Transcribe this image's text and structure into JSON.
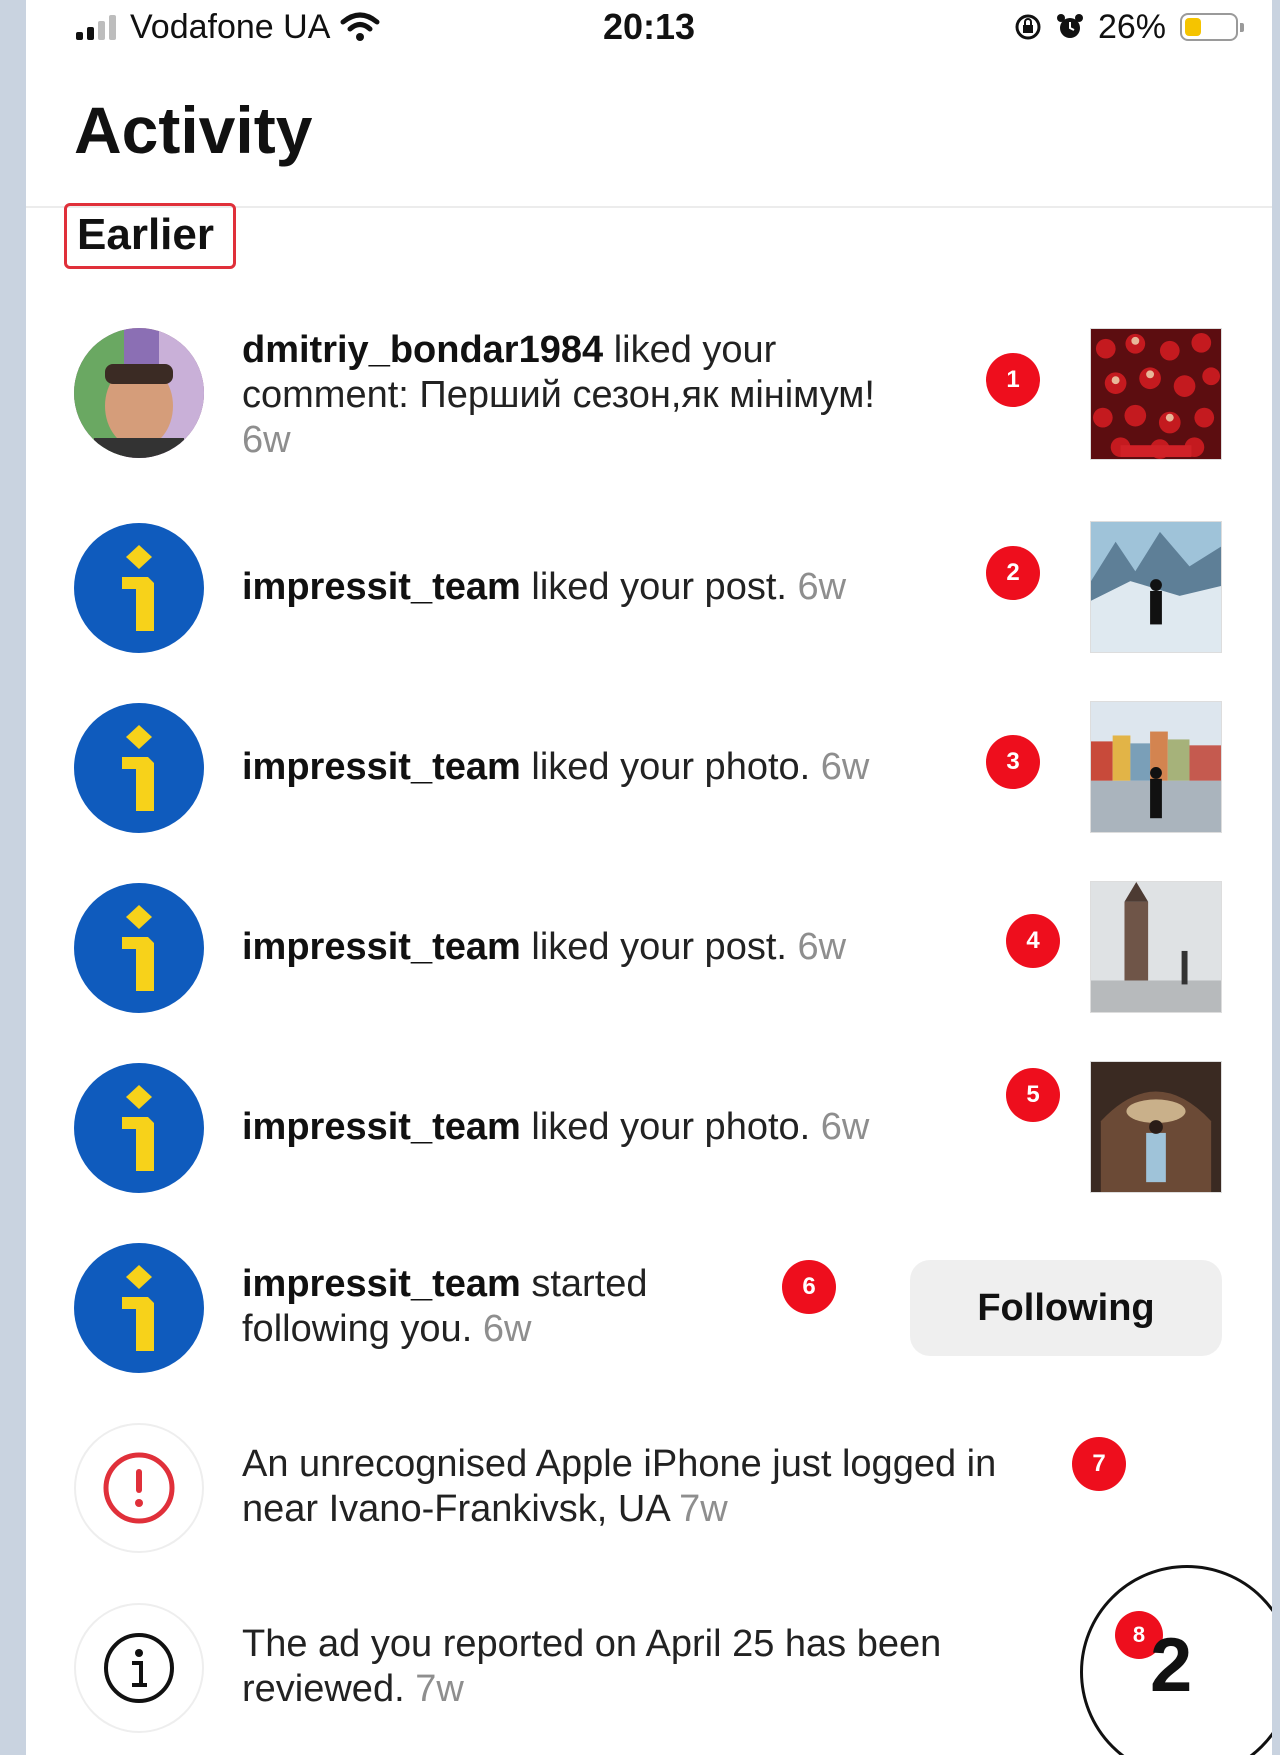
{
  "status_bar": {
    "carrier": "Vodafone UA",
    "time": "20:13",
    "battery": "26%",
    "battery_level": 0.26
  },
  "header": {
    "title": "Activity"
  },
  "section": {
    "label": "Earlier"
  },
  "notifications": [
    {
      "user": "dmitriy_bondar1984",
      "action": " liked your comment: Перший сезон,як мінімум! ",
      "time": "6w",
      "badge": "1"
    },
    {
      "user": "impressit_team",
      "action": " liked your post. ",
      "time": "6w",
      "badge": "2"
    },
    {
      "user": "impressit_team",
      "action": " liked your photo. ",
      "time": "6w",
      "badge": "3"
    },
    {
      "user": "impressit_team",
      "action": " liked your post. ",
      "time": "6w",
      "badge": "4"
    },
    {
      "user": "impressit_team",
      "action": " liked your photo. ",
      "time": "6w",
      "badge": "5"
    },
    {
      "user": "impressit_team",
      "action": " started following you. ",
      "time": "6w",
      "badge": "6",
      "button": "Following"
    },
    {
      "text": "An unrecognised Apple iPhone just logged in near Ivano-Frankivsk, UA ",
      "time": "7w",
      "badge": "7",
      "icon": "alert-icon"
    },
    {
      "text": "The ad you reported on April 25 has been reviewed. ",
      "time": "7w",
      "badge": "8",
      "icon": "info-icon"
    }
  ],
  "overlay": {
    "number": "2"
  },
  "colors": {
    "badge": "#ee0e1d",
    "avatar_blue": "#0f5bbd",
    "avatar_yellow": "#f7d21a",
    "alert_red": "#e0303a"
  }
}
